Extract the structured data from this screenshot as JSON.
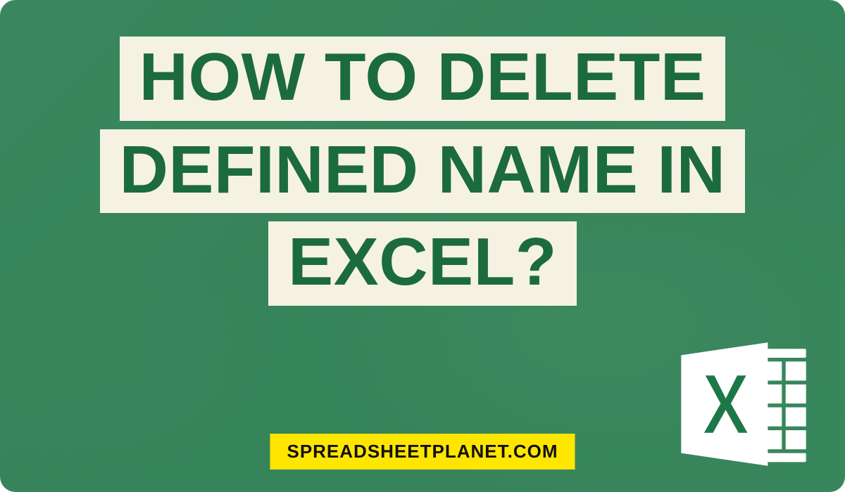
{
  "headline": {
    "line1": "HOW TO DELETE",
    "line2": "DEFINED NAME IN",
    "line3": "EXCEL?"
  },
  "site_label": "SPREADSHEETPLANET.COM",
  "colors": {
    "overlay": "#1d7849",
    "text": "#1b6b3d",
    "box_bg": "#f6f2e3",
    "pill_bg": "#ffe600",
    "icon_fill": "#ffffff"
  }
}
